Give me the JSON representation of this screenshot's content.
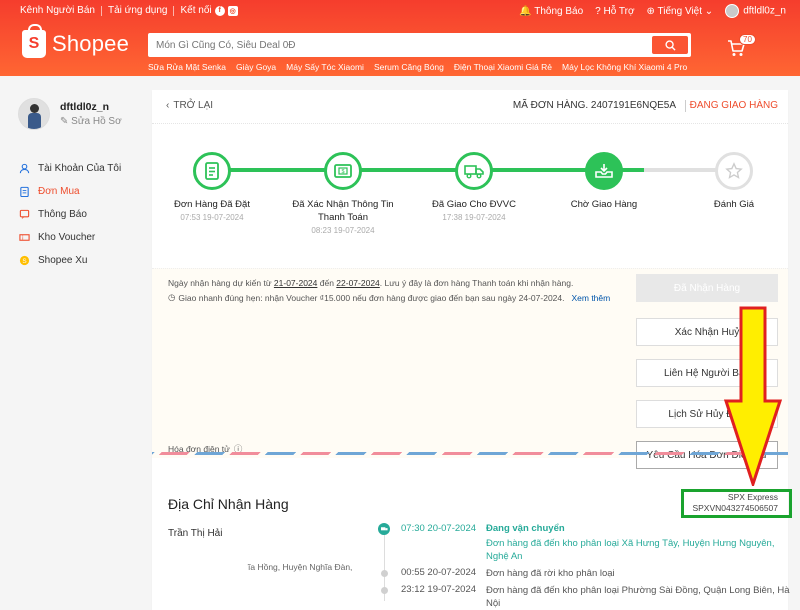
{
  "topbar": {
    "left": [
      "Kênh Người Bán",
      "Tải ứng dụng",
      "Kết nối"
    ],
    "notifications": "Thông Báo",
    "help": "Hỗ Trợ",
    "language": "Tiếng Việt",
    "username": "dftldl0z_n"
  },
  "header": {
    "logo": "Shopee",
    "logo_letter": "S",
    "search_placeholder": "Món Gì Cũng Có, Siêu Deal 0Đ",
    "suggestions": [
      "Sữa Rửa Mặt Senka",
      "Giày Goya",
      "Máy Sấy Tóc Xiaomi",
      "Serum Căng Bóng",
      "Điện Thoại Xiaomi Giá Rẻ",
      "Máy Lọc Không Khí Xiaomi 4 Pro"
    ],
    "cart_count": "70"
  },
  "sidebar": {
    "username": "dftldl0z_n",
    "edit_profile": "✎ Sửa Hồ Sơ",
    "items": [
      {
        "label": "Tài Khoản Của Tôi",
        "icon": "user-icon"
      },
      {
        "label": "Đơn Mua",
        "icon": "clipboard-icon",
        "active": true
      },
      {
        "label": "Thông Báo",
        "icon": "bell-icon"
      },
      {
        "label": "Kho Voucher",
        "icon": "voucher-icon"
      },
      {
        "label": "Shopee Xu",
        "icon": "coin-icon"
      }
    ]
  },
  "order": {
    "back": "TRỞ LẠI",
    "order_id": "MÃ ĐƠN HÀNG. 2407191E6NQE5A",
    "status": "ĐANG GIAO HÀNG",
    "steps": [
      {
        "label": "Đơn Hàng Đã Đặt",
        "time": "07:53 19-07-2024"
      },
      {
        "label": "Đã Xác Nhận Thông Tin Thanh Toán",
        "time": "08:23 19-07-2024"
      },
      {
        "label": "Đã Giao Cho ĐVVC",
        "time": "17:38 19-07-2024"
      },
      {
        "label": "Chờ Giao Hàng",
        "time": ""
      },
      {
        "label": "Đánh Giá",
        "time": ""
      }
    ],
    "notice_pre": "Ngày nhận hàng dự kiến từ ",
    "notice_from": "21-07-2024",
    "notice_mid": " đến ",
    "notice_to": "22-07-2024",
    "notice_post": ". Lưu ý đây là đơn hàng Thanh toán khi nhận hàng.",
    "notice_fast": "Giao nhanh đúng hẹn: nhận Voucher ₫15.000 nếu đơn hàng được giao đến bạn sau ngày 24-07-2024.",
    "notice_more": "Xem thêm",
    "invoice": "Hóa đơn điện tử",
    "buttons": [
      "Đã Nhận Hàng",
      "Xác Nhận Huỷ",
      "Liên Hệ Người Bán",
      "Lịch Sử Hủy Đơn",
      "Yêu Cầu Hóa Đơn Điện Tử"
    ]
  },
  "address": {
    "title": "Địa Chỉ Nhận Hàng",
    "carrier": "SPX Express",
    "tracking": "SPXVN043274506507",
    "name": "Trần Thị Hải",
    "line": "ĩa Hồng, Huyện Nghĩa Đàn,"
  },
  "timeline": [
    {
      "time": "07:30 20-07-2024",
      "status": "Đang vận chuyển",
      "desc": "Đơn hàng đã đến kho phân loại Xã Hưng Tây, Huyện Hưng Nguyên,",
      "desc2": "Nghệ An"
    },
    {
      "time": "00:55 20-07-2024",
      "desc": "Đơn hàng đã rời kho phân loại"
    },
    {
      "time": "23:12 19-07-2024",
      "desc": "Đơn hàng đã đến kho phân loại Phường Sài Đồng, Quận Long Biên, Hà",
      "desc2": "Nội"
    }
  ],
  "colors": {
    "brand": "#ee4d2d",
    "success": "#2dc258",
    "teal": "#26aa99",
    "highlight_box": "#1aa32e",
    "arrow_fill": "#ffee00",
    "arrow_stroke": "#e02020"
  }
}
